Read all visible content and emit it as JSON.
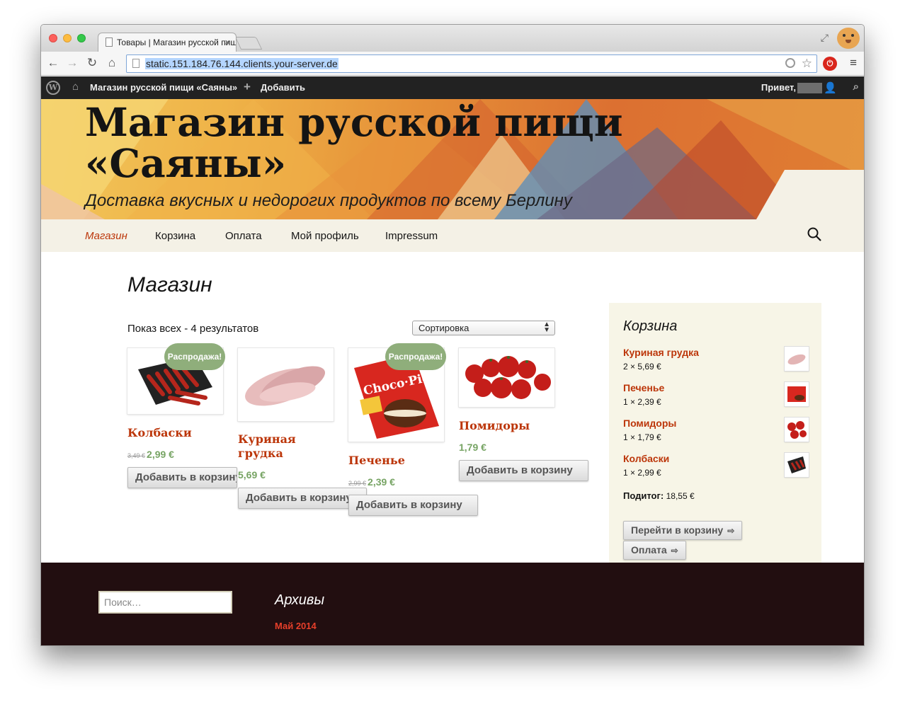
{
  "browser": {
    "tab_title": "Товары | Магазин русской пищи «Саяны»",
    "tab_close": "×",
    "url": "static.151.184.76.144.clients.your-server.de",
    "back_icon": "back-arrow-icon",
    "forward_icon": "forward-arrow-icon",
    "reload_icon": "reload-icon",
    "home_icon": "home-icon"
  },
  "adminbar": {
    "site_name": "Магазин русской пищи «Саяны»",
    "add_label": "Добавить",
    "greeting": "Привет,"
  },
  "header": {
    "title": "Магазин русской пищи «Саяны»",
    "description": "Доставка вкусных и недорогих продуктов по всему Берлину"
  },
  "nav": {
    "items": [
      {
        "label": "Магазин",
        "current": true
      },
      {
        "label": "Корзина",
        "current": false
      },
      {
        "label": "Оплата",
        "current": false
      },
      {
        "label": "Мой профиль",
        "current": false
      },
      {
        "label": "Impressum",
        "current": false
      }
    ]
  },
  "shop": {
    "title": "Магазин",
    "result_count": "Показ всех - 4 результатов",
    "orderby": "Сортировка",
    "sale_label": "Распродажа!",
    "add_to_cart": "Добавить в корзину",
    "products": [
      {
        "name": "Колбаски",
        "old_price": "3,49 €",
        "price": "2,99 €",
        "sale": true
      },
      {
        "name": "Куриная грудка",
        "old_price": "",
        "price": "5,69 €",
        "sale": false
      },
      {
        "name": "Печенье",
        "old_price": "2,99 €",
        "price": "2,39 €",
        "sale": true
      },
      {
        "name": "Помидоры",
        "old_price": "",
        "price": "1,79 €",
        "sale": false
      }
    ]
  },
  "cart": {
    "title": "Корзина",
    "items": [
      {
        "name": "Куриная грудка",
        "qty": "2 × 5,69 €"
      },
      {
        "name": "Печенье",
        "qty": "1 × 2,39 €"
      },
      {
        "name": "Помидоры",
        "qty": "1 × 1,79 €"
      },
      {
        "name": "Колбаски",
        "qty": "1 × 2,99 €"
      }
    ],
    "subtotal_label": "Подитог:",
    "subtotal_value": "18,55 €",
    "view_cart": "Перейти в корзину",
    "checkout": "Оплата"
  },
  "footer": {
    "search_placeholder": "Поиск…",
    "archives_title": "Архивы",
    "archive_link": "Май 2014"
  },
  "colors": {
    "accent": "#bc360a",
    "price": "#77a464",
    "sale_badge": "#8fae7b",
    "footer_bg": "#220e10"
  }
}
